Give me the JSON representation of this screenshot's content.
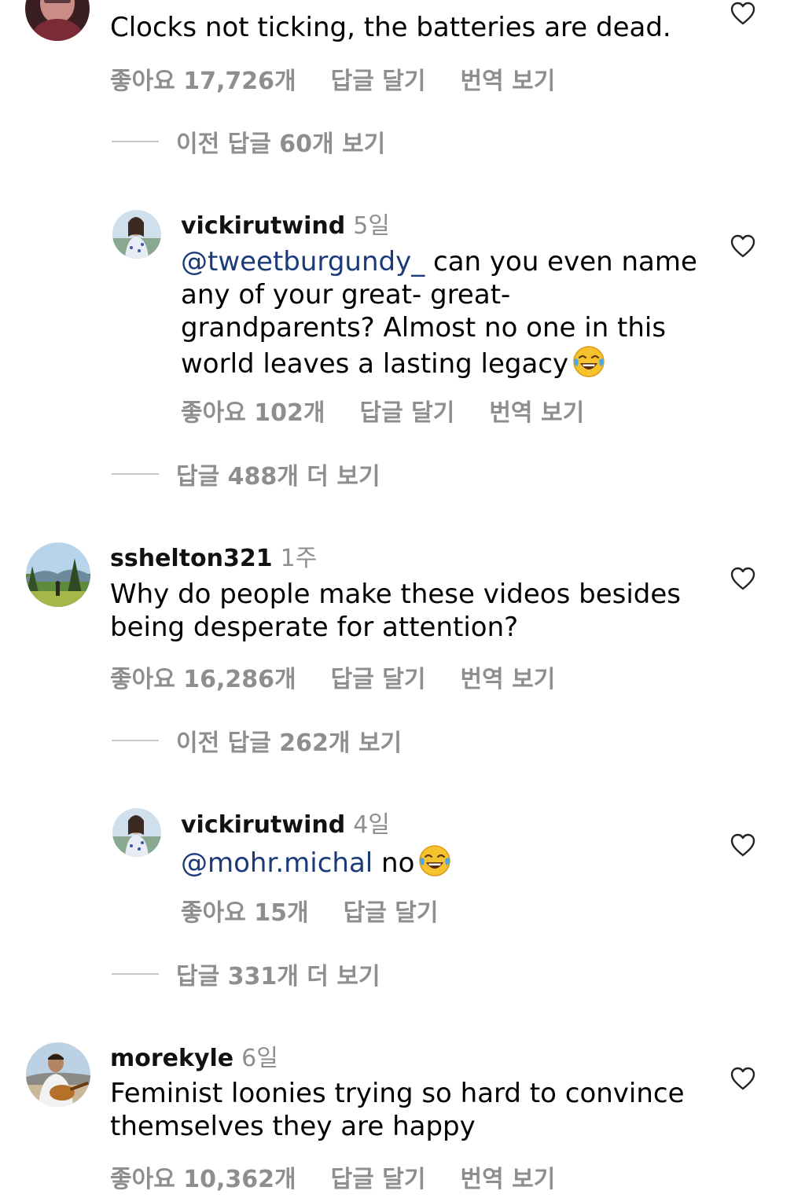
{
  "comments": [
    {
      "text": "Clocks not ticking, the batteries are dead.",
      "likes": "좋아요 17,726개",
      "reply": "답글 달기",
      "translate": "번역 보기",
      "view_replies": "이전 답글 60개 보기"
    },
    {
      "username": "vickirutwind",
      "time": "5일",
      "mention": "@tweetburgundy_",
      "text": " can you even name any of your great- great-grandparents? Almost no one in this world leaves a lasting legacy",
      "emoji": "face-with-tears-of-joy",
      "likes": "좋아요 102개",
      "reply": "답글 달기",
      "translate": "번역 보기",
      "view_replies": "답글 488개 더 보기"
    },
    {
      "username": "sshelton321",
      "time": "1주",
      "text": "Why do people make these videos besides being desperate for attention?",
      "likes": "좋아요 16,286개",
      "reply": "답글 달기",
      "translate": "번역 보기",
      "view_replies": "이전 답글 262개 보기"
    },
    {
      "username": "vickirutwind",
      "time": "4일",
      "mention": "@mohr.michal",
      "text": " no",
      "emoji": "face-with-tears-of-joy",
      "likes": "좋아요 15개",
      "reply": "답글 달기",
      "view_replies": "답글 331개 더 보기"
    },
    {
      "username": "morekyle",
      "time": "6일",
      "text": "Feminist loonies trying so hard to convince themselves they are happy",
      "likes": "좋아요 10,362개",
      "reply": "답글 달기",
      "translate": "번역 보기"
    }
  ],
  "colors": {
    "secondary_text": "#8e8e8e",
    "mention": "#1b3a7a",
    "divider": "#c7c7c7"
  },
  "icons": {
    "like": "heart-outline-icon",
    "emoji": "face-with-tears-of-joy"
  }
}
